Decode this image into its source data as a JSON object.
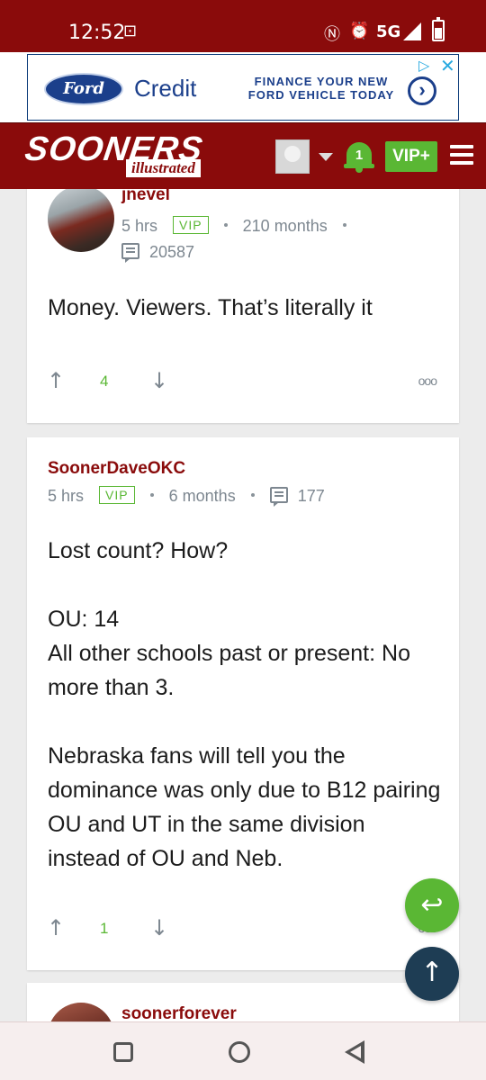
{
  "status_bar": {
    "time": "12:52",
    "network": "5G",
    "icons": [
      "cast-icon",
      "nfc-icon",
      "alarm-icon",
      "signal-icon",
      "battery-icon"
    ]
  },
  "ad": {
    "brand_logo": "Ford",
    "brand_product": "Credit",
    "headline_line1": "FINANCE YOUR NEW",
    "headline_line2": "FORD VEHICLE TODAY",
    "choices_icon": "▷",
    "close_icon": "✕"
  },
  "header": {
    "logo_main": "SOONERS",
    "logo_sub": "illustrated",
    "notification_count": "1",
    "vip_label": "VIP+"
  },
  "comments": [
    {
      "username": "jnevel",
      "time_ago": "5 hrs",
      "badge": "VIP",
      "membership": "210 months",
      "post_count": "20587",
      "body": "Money. Viewers. That’s literally it",
      "votes": "4"
    },
    {
      "username": "SoonerDaveOKC",
      "time_ago": "5 hrs",
      "badge": "VIP",
      "membership": "6 months",
      "post_count": "177",
      "body": "Lost count? How?\n\nOU: 14\nAll other schools past or present: No more than 3.\n\nNebraska fans will tell you the dominance was only due to B12 pairing OU and UT in the same division instead of OU and Neb.",
      "votes": "1"
    },
    {
      "username": "soonerforever"
    }
  ],
  "controls": {
    "upvote_icon": "↑",
    "downvote_icon": "↓",
    "more_icon": "ooo",
    "reply_icon": "↩",
    "scroll_top_icon": "↑"
  },
  "colors": {
    "brand_crimson": "#8a0b0b",
    "vip_green": "#5ab734",
    "meta_gray": "#7d8790",
    "ford_blue": "#1b3f8b",
    "scroll_top_navy": "#1e3d54"
  }
}
